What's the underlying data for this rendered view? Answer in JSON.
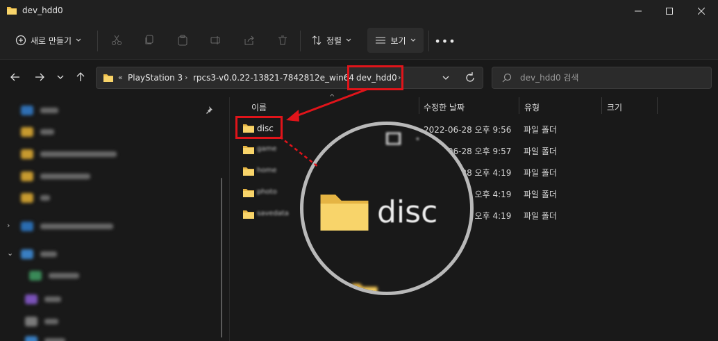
{
  "window": {
    "title": "dev_hdd0"
  },
  "toolbar": {
    "new_label": "새로 만들기",
    "sort_label": "정렬",
    "view_label": "보기",
    "more_label": "•••"
  },
  "address": {
    "overflow": "«",
    "crumbs": [
      "PlayStation 3",
      "rpcs3-v0.0.22-13821-7842812e_win64",
      "dev_hdd0"
    ]
  },
  "search": {
    "placeholder": "dev_hdd0 검색"
  },
  "columns": {
    "name": "이름",
    "modified": "수정한 날짜",
    "type": "유형",
    "size": "크기"
  },
  "files": [
    {
      "name": "disc",
      "date": "2022-06-28 오후 9:56",
      "type": "파일 폴더"
    },
    {
      "name": "game",
      "date": "2022-06-28 오후 9:57",
      "type": "파일 폴더"
    },
    {
      "name": "home",
      "date": "2022-06-28 오후 4:19",
      "type": "파일 폴더"
    },
    {
      "name": "photo",
      "date": "2022-06-28 오후 4:19",
      "type": "파일 폴더"
    },
    {
      "name": "savedata",
      "date": "2022-06-28 오후 4:19",
      "type": "파일 폴더"
    }
  ],
  "magnifier": {
    "label": "disc"
  },
  "colors": {
    "highlight": "#e0141a",
    "folder": "#f2c14b",
    "background": "#191919"
  }
}
